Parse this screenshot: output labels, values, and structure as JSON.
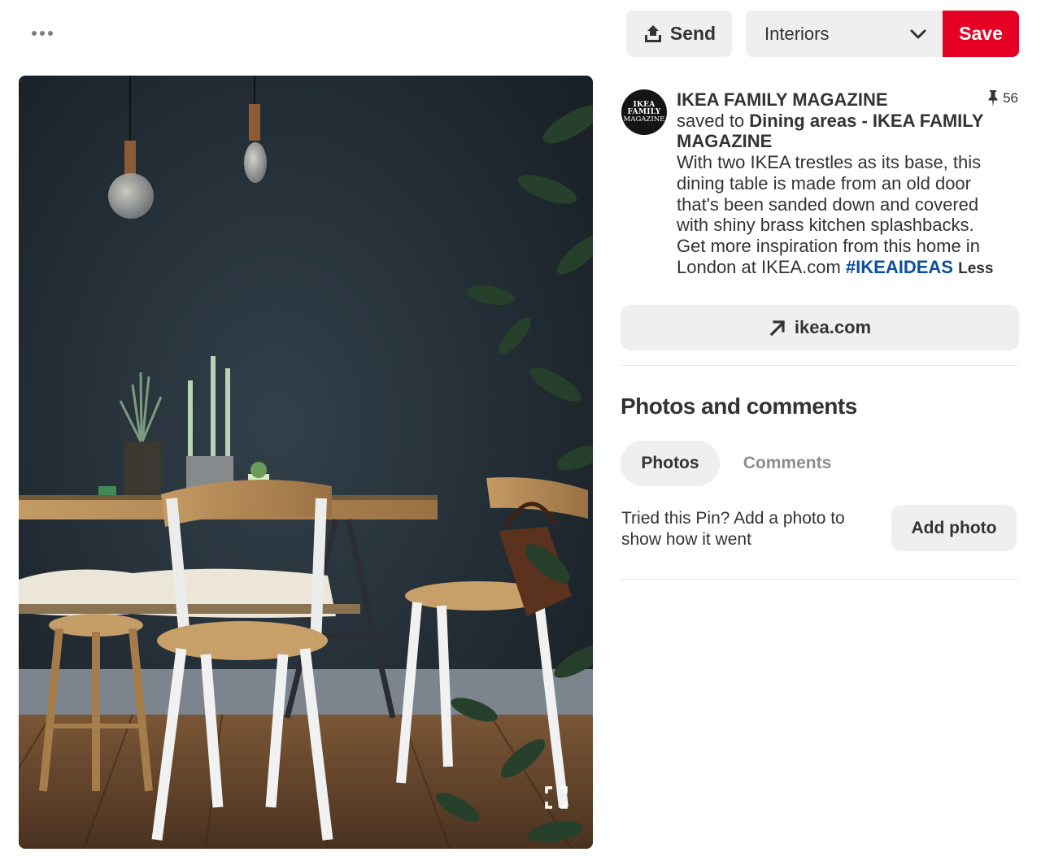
{
  "header": {
    "more_icon": "ellipsis-icon",
    "send": {
      "label": "Send",
      "icon": "share-upload-icon"
    },
    "board_select": {
      "value": "Interiors",
      "icon": "chevron-down-icon"
    },
    "save": {
      "label": "Save",
      "color": "#e60023"
    }
  },
  "pin": {
    "image_alt": "Dark teal dining room with wooden table, bentwood chairs, candles, pendant bulbs and plant",
    "expand_icon": "expand-corners-icon",
    "saves_count": "56",
    "saves_icon": "pushpin-icon"
  },
  "author": {
    "avatar_text": [
      "IKEA",
      "FAMILY",
      "MAGAZINE"
    ],
    "name": "IKEA FAMILY MAGAZINE",
    "saved_to_prefix": "saved to",
    "board_name": "Dining areas - IKEA FAMILY MAGAZINE"
  },
  "description": {
    "text": "With two IKEA trestles as its base, this dining table is made from an old door that's been sanded down and covered with shiny brass kitchen splashbacks. Get more inspiration from this home in London at IKEA.com",
    "hashtag": "#IKEAIDEAS",
    "less_label": "Less",
    "hashtag_color": "#0a4fa0"
  },
  "source_link": {
    "label": "ikea.com",
    "icon": "arrow-up-right-icon"
  },
  "comments_section": {
    "title": "Photos and comments",
    "tabs": [
      {
        "label": "Photos",
        "active": true
      },
      {
        "label": "Comments",
        "active": false
      }
    ],
    "tried_prompt": "Tried this Pin? Add a photo to show how it went",
    "add_photo_label": "Add photo"
  }
}
